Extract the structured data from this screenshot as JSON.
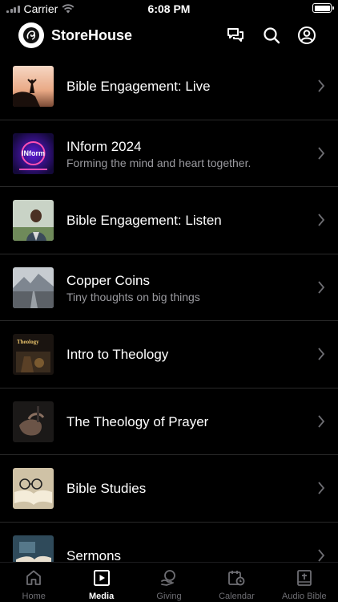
{
  "status": {
    "carrier": "Carrier",
    "time": "6:08 PM"
  },
  "header": {
    "title": "StoreHouse"
  },
  "items": [
    {
      "title": "Bible Engagement: Live",
      "subtitle": ""
    },
    {
      "title": "INform 2024",
      "subtitle": "Forming the mind and heart together."
    },
    {
      "title": "Bible Engagement: Listen",
      "subtitle": ""
    },
    {
      "title": "Copper Coins",
      "subtitle": "Tiny thoughts on big things"
    },
    {
      "title": "Intro to Theology",
      "subtitle": ""
    },
    {
      "title": "The Theology of Prayer",
      "subtitle": ""
    },
    {
      "title": "Bible Studies",
      "subtitle": ""
    },
    {
      "title": "Sermons",
      "subtitle": ""
    }
  ],
  "thumb_text": {
    "inform": "INform",
    "theology": "Theology"
  },
  "tabs": [
    {
      "label": "Home",
      "icon": "home-icon"
    },
    {
      "label": "Media",
      "icon": "media-icon"
    },
    {
      "label": "Giving",
      "icon": "giving-icon"
    },
    {
      "label": "Calendar",
      "icon": "calendar-icon"
    },
    {
      "label": "Audio Bible",
      "icon": "audio-bible-icon"
    }
  ],
  "active_tab": "Media",
  "colors": {
    "background": "#000000",
    "subtitle": "#9a9a9f",
    "inactive_tab": "#6e6e73",
    "active_tab": "#ffffff"
  }
}
